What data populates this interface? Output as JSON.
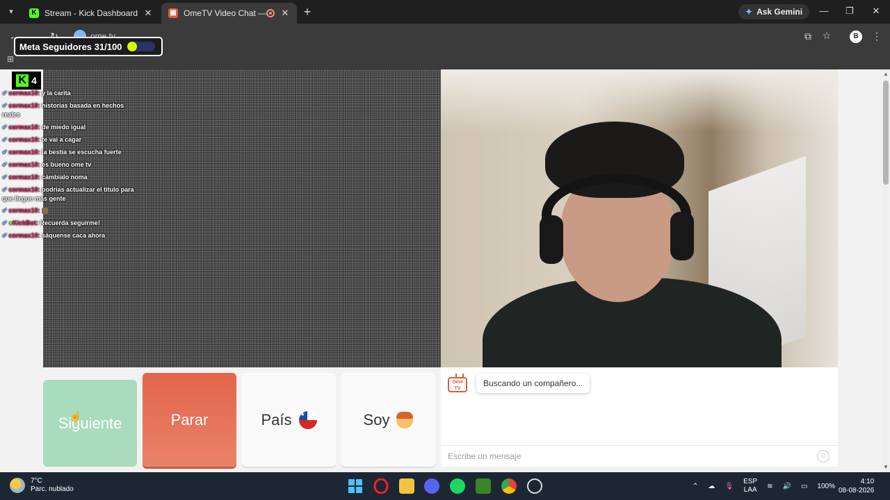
{
  "browser": {
    "tabs": [
      {
        "title": "Stream - Kick Dashboard",
        "active": false
      },
      {
        "title": "OmeTV Video Chat — Ome",
        "active": true
      }
    ],
    "gemini_label": "Ask Gemini",
    "url": "ome.tv"
  },
  "overlay": {
    "goal_label": "Meta Seguidores 31/100",
    "goal_progress": 0.31,
    "viewer_count": "4",
    "chat": [
      {
        "user": "cormax10:",
        "text": "y la carita"
      },
      {
        "user": "cormax10:",
        "text": "historias basada en hechos",
        "cont": "reales"
      },
      {
        "user": "cormax10:",
        "text": "de miedo igual"
      },
      {
        "user": "cormax10:",
        "text": "te vai a cagar"
      },
      {
        "user": "cormax10:",
        "text": "la bestia se escucha fuerte"
      },
      {
        "user": "cormax10:",
        "text": "es bueno ome tv"
      },
      {
        "user": "cormax10:",
        "text": "cámbialo noma"
      },
      {
        "user": "cormax10:",
        "text": "podrias actualizar el titulo para",
        "cont": "que llegue más gente"
      },
      {
        "user": "cormax10:",
        "text": ""
      },
      {
        "user": "KickBot:",
        "text": "Recuerda seguirme!"
      },
      {
        "user": "cormax10:",
        "text": "sáquense caca ahora"
      }
    ]
  },
  "controls": {
    "next_label": "Siguiente",
    "stop_label": "Parar",
    "country_label": "País",
    "gender_label": "Soy"
  },
  "chat_panel": {
    "status": "Buscando un compañero...",
    "input_placeholder": "Escribe un mensaje",
    "logo_text": "Ome TV"
  },
  "taskbar": {
    "temperature": "7°C",
    "condition": "Parc. nublado",
    "language": "ESP",
    "layout": "LAA",
    "battery": "100%",
    "time": "4:10",
    "date": "08-08-2026"
  }
}
